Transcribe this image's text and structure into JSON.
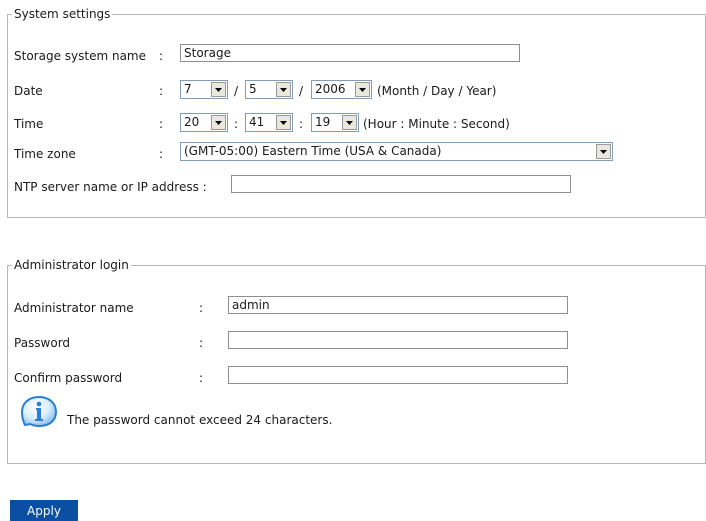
{
  "system_settings": {
    "legend": "System settings",
    "storage_name_label": "Storage system name",
    "storage_name_value": "Storage",
    "date_label": "Date",
    "date_month": "7",
    "date_day": "5",
    "date_year": "2006",
    "date_sep": "/",
    "date_hint": "(Month / Day / Year)",
    "time_label": "Time",
    "time_hour": "20",
    "time_minute": "41",
    "time_second": "19",
    "time_sep": ":",
    "time_hint": "(Hour : Minute : Second)",
    "timezone_label": "Time zone",
    "timezone_value": "(GMT-05:00) Eastern Time (USA & Canada)",
    "ntp_label": "NTP server name or IP address :",
    "ntp_value": ""
  },
  "admin_login": {
    "legend": "Administrator login",
    "name_label": "Administrator name",
    "name_value": "admin",
    "password_label": "Password",
    "password_value": "",
    "confirm_label": "Confirm password",
    "confirm_value": "",
    "info_text": "The password cannot exceed 24 characters."
  },
  "colon": ":",
  "apply_label": "Apply",
  "colors": {
    "apply_bg": "#0b4fa3",
    "border": "#b7b7b7",
    "info_icon": "#2a7fd4"
  },
  "icons": {
    "dropdown": "chevron-down-icon",
    "info": "info-icon"
  }
}
